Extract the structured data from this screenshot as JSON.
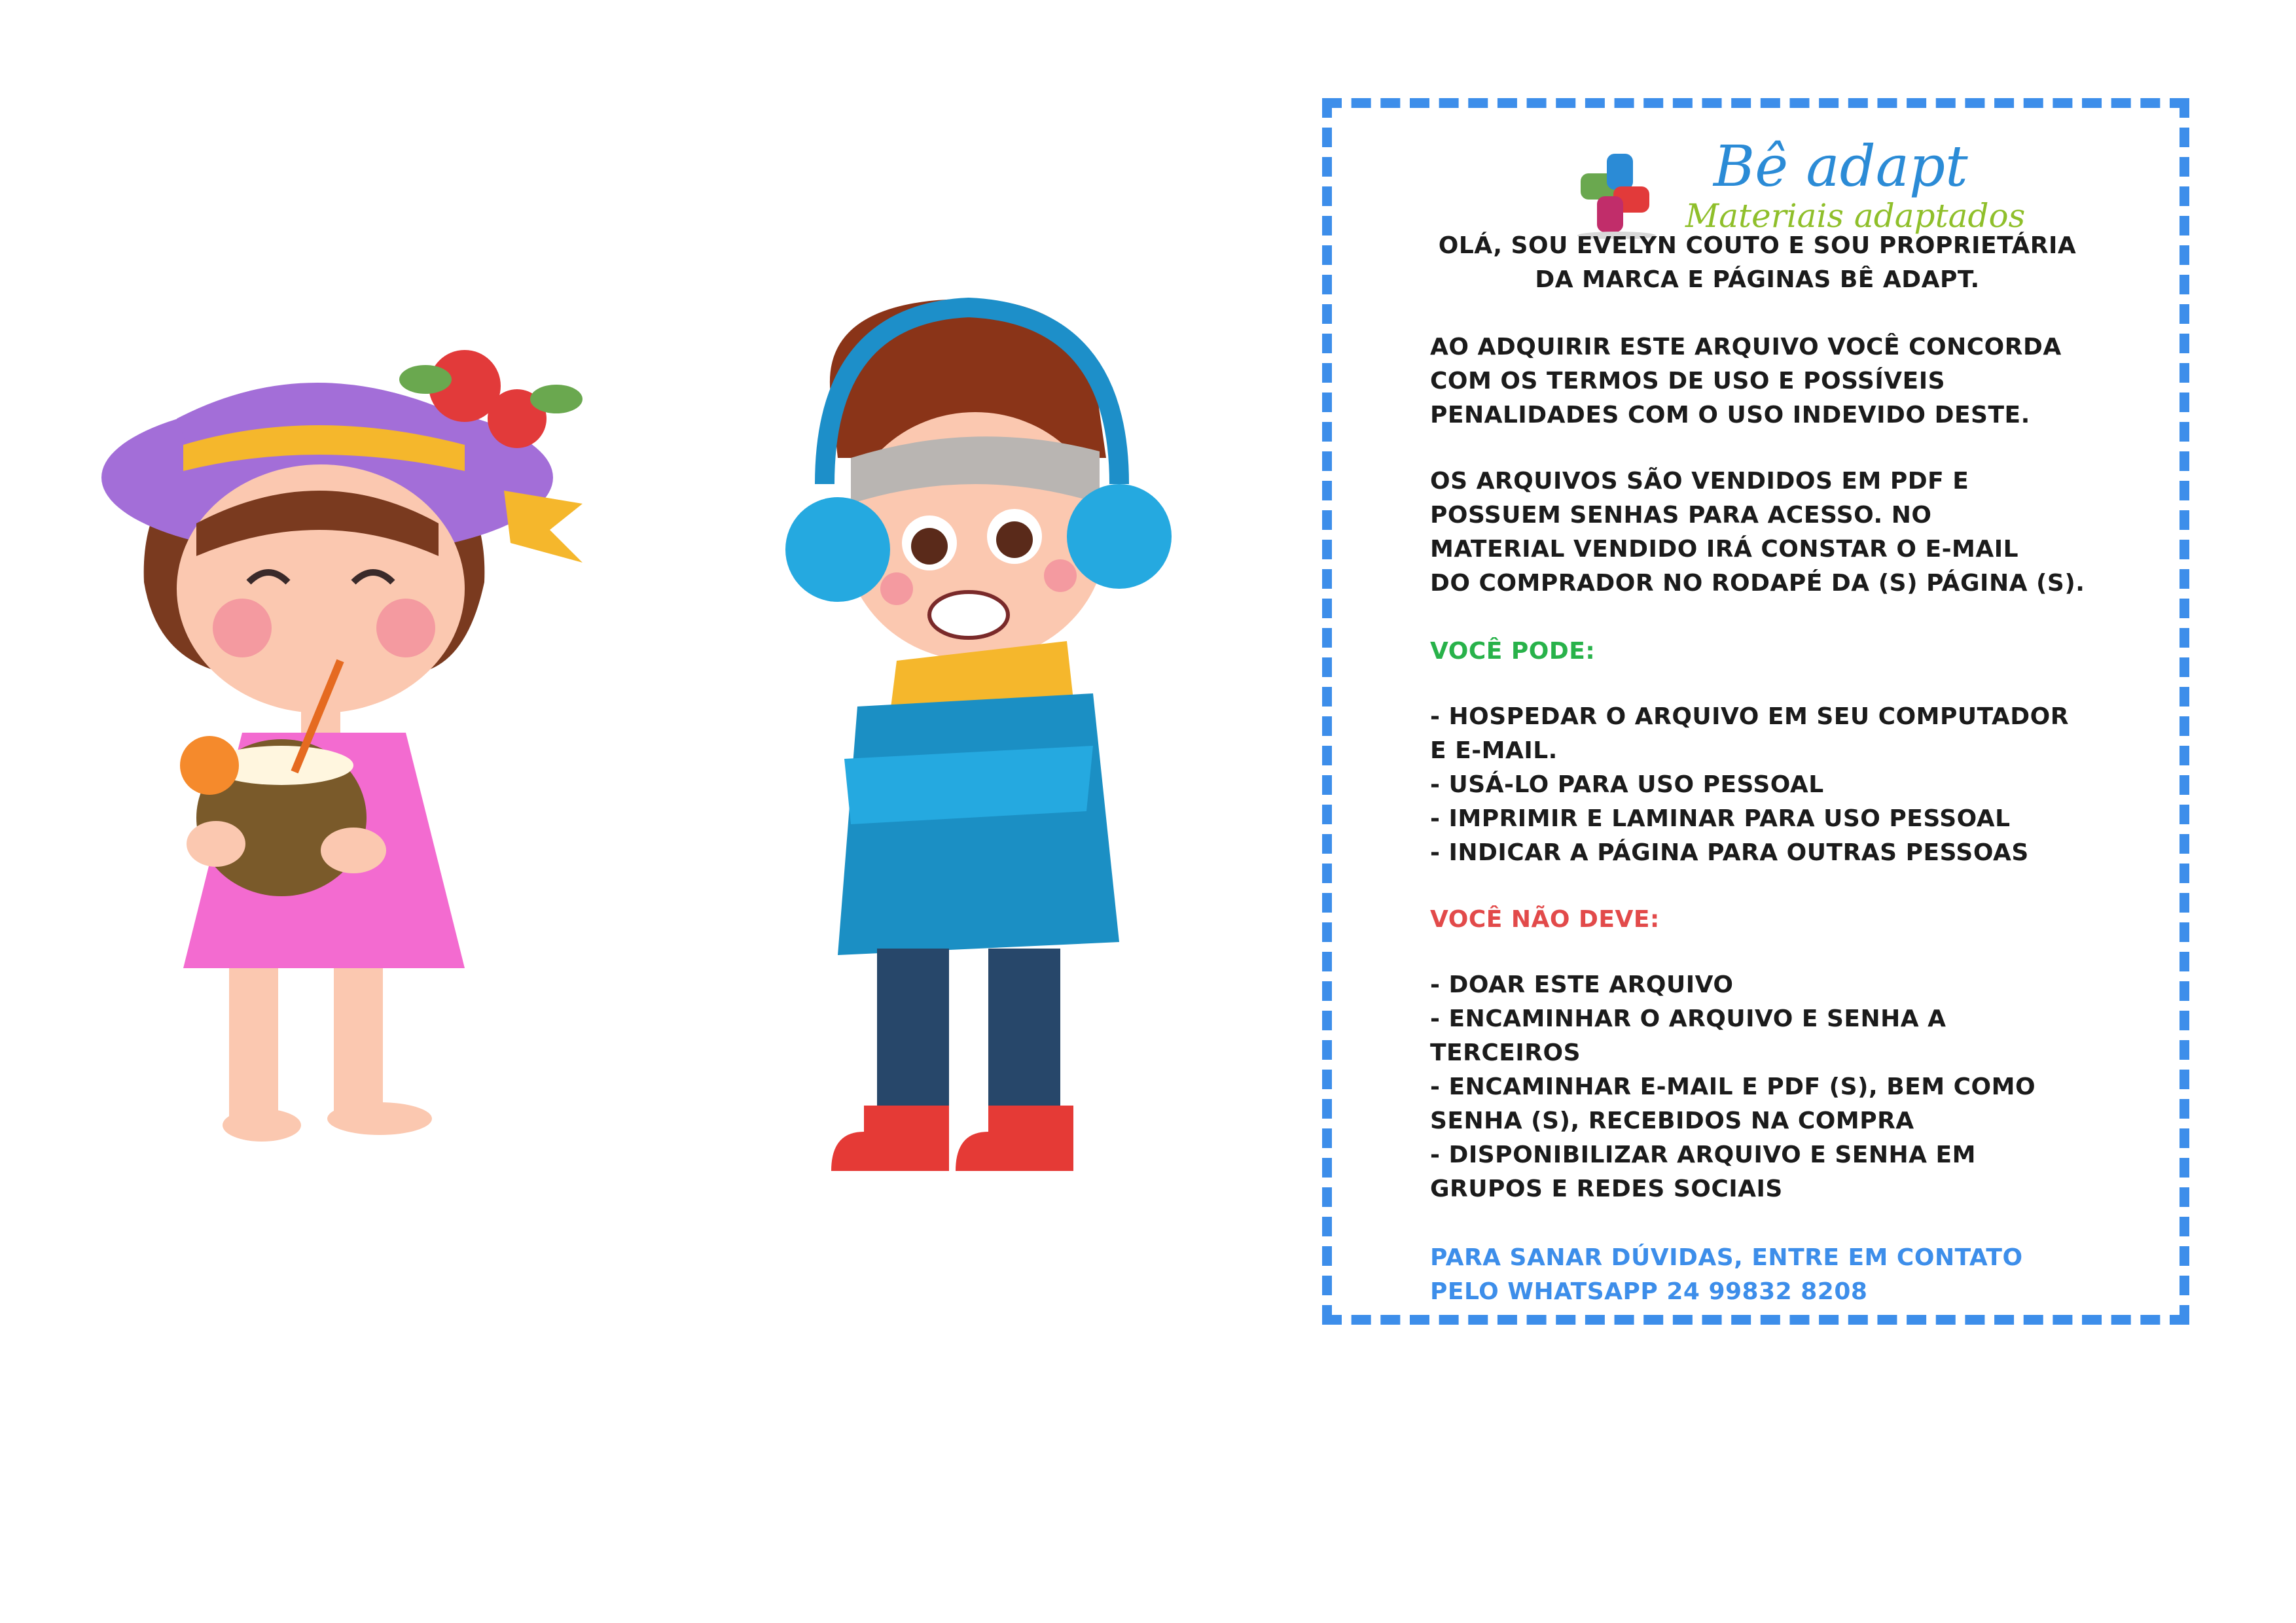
{
  "illustrations": {
    "girl": "summer-girl-with-coconut",
    "boy": "winter-boy-shivering"
  },
  "card": {
    "border_color": "#3d8eea",
    "logo": {
      "title": "Bê adapt",
      "subtitle": "Materiais adaptados"
    },
    "intro": [
      "OLÁ, SOU EVELYN COUTO E SOU PROPRIETÁRIA",
      "DA MARCA E PÁGINAS BÊ ADAPT."
    ],
    "agree": [
      "AO ADQUIRIR ESTE ARQUIVO VOCÊ CONCORDA",
      "COM OS TERMOS DE USO E POSSÍVEIS",
      "PENALIDADES COM O USO INDEVIDO DESTE."
    ],
    "files": [
      "OS ARQUIVOS SÃO VENDIDOS EM PDF E",
      "POSSUEM SENHAS PARA ACESSO. NO",
      "MATERIAL VENDIDO IRÁ CONSTAR O E-MAIL",
      "DO COMPRADOR NO RODAPÉ DA (S) PÁGINA (S)."
    ],
    "can_heading": "VOCÊ PODE:",
    "can_items": [
      "- HOSPEDAR O ARQUIVO EM SEU COMPUTADOR",
      "E E-MAIL.",
      "- USÁ-LO PARA USO PESSOAL",
      "- IMPRIMIR E LAMINAR PARA USO PESSOAL",
      "- INDICAR A PÁGINA PARA OUTRAS PESSOAS"
    ],
    "cannot_heading": "VOCÊ NÃO DEVE:",
    "cannot_items": [
      "- DOAR ESTE ARQUIVO",
      "- ENCAMINHAR O ARQUIVO E SENHA A",
      "TERCEIROS",
      "- ENCAMINHAR E-MAIL E PDF (S), BEM COMO",
      "SENHA (S), RECEBIDOS NA COMPRA",
      "- DISPONIBILIZAR ARQUIVO E SENHA EM",
      "GRUPOS E REDES SOCIAIS"
    ],
    "contact": [
      "PARA SANAR DÚVIDAS, ENTRE EM CONTATO",
      "PELO WHATSAPP 24 99832 8208"
    ]
  }
}
